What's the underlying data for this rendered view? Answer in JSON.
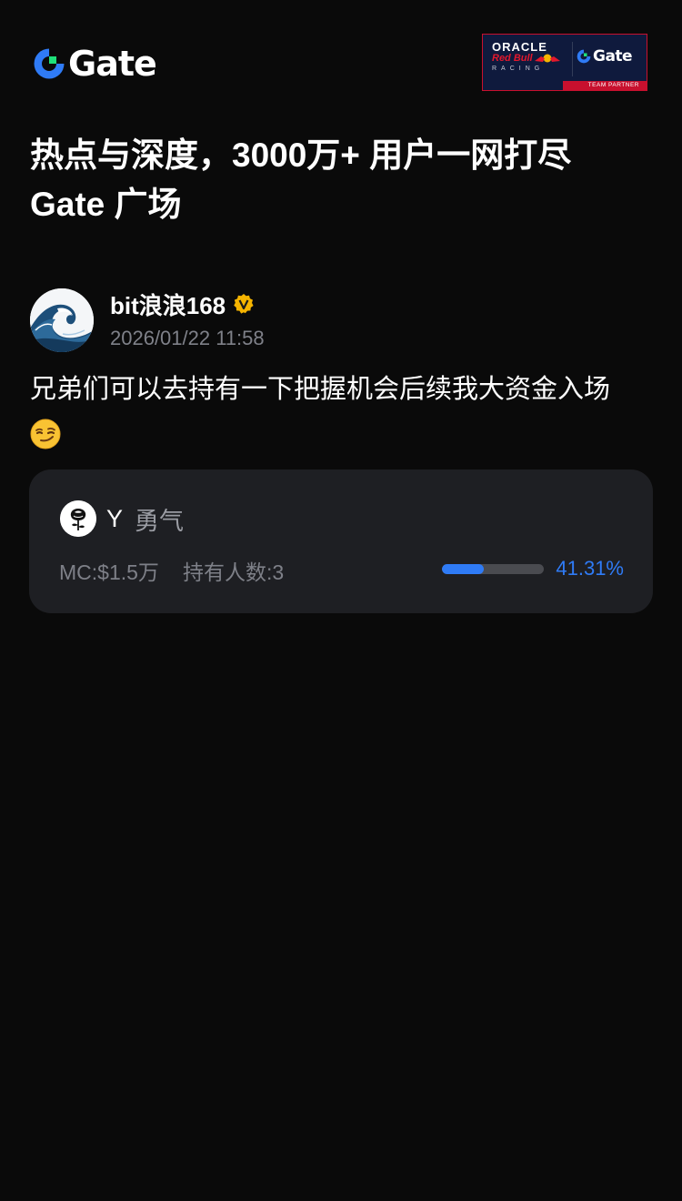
{
  "brand": {
    "name": "Gate",
    "accent_color": "#2f7bf6",
    "logo_green": "#1fe07a"
  },
  "partner_badge": {
    "line1": "ORACLE",
    "line2": "Red Bull",
    "line3": "RACING",
    "partner_brand": "Gate",
    "tag": "TEAM PARTNER",
    "colors": {
      "navy": "#0f1a3d",
      "red": "#c8102e"
    }
  },
  "headline": {
    "line1": "热点与深度，3000万+ 用户一网打尽",
    "line2": "Gate 广场"
  },
  "post": {
    "author": {
      "name": "bit浪浪168",
      "verified": true,
      "verified_color": "#f5b400"
    },
    "timestamp": "2026/01/22 11:58",
    "text": "兄弟们可以去持有一下把握机会后续我大资金入场",
    "emoji": "smirk-emoji"
  },
  "token_card": {
    "symbol": "Y",
    "name": "勇气",
    "market_cap": "MC:$1.5万",
    "holders": "持有人数:3",
    "progress_percent": 41.31,
    "progress_label": "41.31%"
  }
}
